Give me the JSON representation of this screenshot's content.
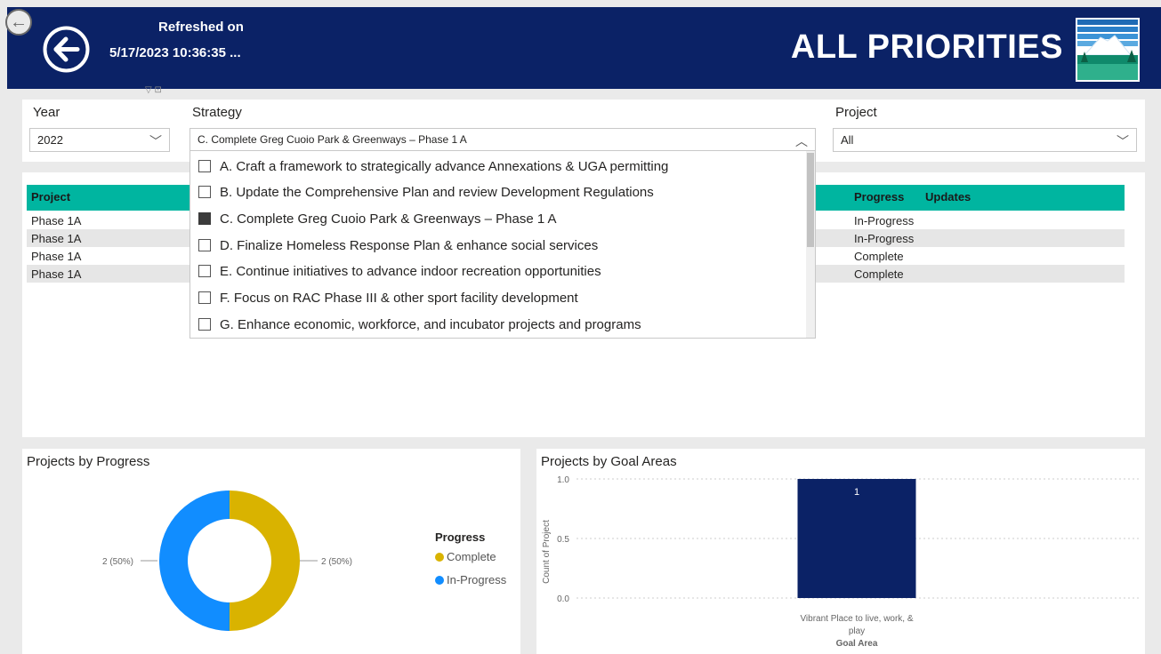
{
  "header": {
    "refreshed_label": "Refreshed on",
    "refreshed_date": "5/17/2023 10:36:35 ...",
    "title": "ALL PRIORITIES",
    "colors": {
      "background": "#0b2266",
      "accent": "#00b5a0"
    }
  },
  "slicers": {
    "year": {
      "label": "Year",
      "value": "2022"
    },
    "strategy": {
      "label": "Strategy",
      "value": "C. Complete Greg Cuoio Park & Greenways – Phase 1 A"
    },
    "project": {
      "label": "Project",
      "value": "All"
    }
  },
  "strategy_options": [
    {
      "label": "A. Craft a framework to strategically advance Annexations & UGA permitting",
      "checked": false
    },
    {
      "label": "B. Update the Comprehensive Plan and review Development Regulations",
      "checked": false
    },
    {
      "label": "C. Complete Greg Cuoio Park & Greenways – Phase 1 A",
      "checked": true
    },
    {
      "label": "D. Finalize Homeless Response Plan & enhance social services",
      "checked": false
    },
    {
      "label": "E. Continue initiatives to advance indoor recreation opportunities",
      "checked": false
    },
    {
      "label": "F. Focus on RAC Phase III & other sport facility development",
      "checked": false
    },
    {
      "label": "G. Enhance economic, workforce, and incubator projects and programs",
      "checked": false
    }
  ],
  "table": {
    "columns": {
      "project": "Project",
      "progress": "Progress",
      "updates": "Updates"
    },
    "rows": [
      {
        "project": "Phase 1A",
        "progress": "In-Progress"
      },
      {
        "project": "Phase 1A",
        "progress": "In-Progress"
      },
      {
        "project": "Phase 1A",
        "progress": "Complete"
      },
      {
        "project": "Phase 1A",
        "progress": "Complete"
      }
    ]
  },
  "chart_data": [
    {
      "type": "pie",
      "title": "Projects by Progress",
      "legend_title": "Progress",
      "legend_position": "right",
      "slices": [
        {
          "name": "Complete",
          "value": 2,
          "label": "2 (50%)",
          "color": "#d9b300"
        },
        {
          "name": "In-Progress",
          "value": 2,
          "label": "2 (50%)",
          "color": "#118dff"
        }
      ]
    },
    {
      "type": "bar",
      "title": "Projects by Goal Areas",
      "xlabel": "Goal Area",
      "ylabel": "Count of Project",
      "categories": [
        "Vibrant Place to live, work, & play"
      ],
      "category_lines": [
        "Vibrant Place to live, work, &",
        "play"
      ],
      "values": [
        1
      ],
      "data_labels": [
        "1"
      ],
      "ylim": [
        0,
        1
      ],
      "yticks": [
        "1.0",
        "0.5",
        "0.0"
      ],
      "color": "#0b2266",
      "grid": true
    }
  ]
}
